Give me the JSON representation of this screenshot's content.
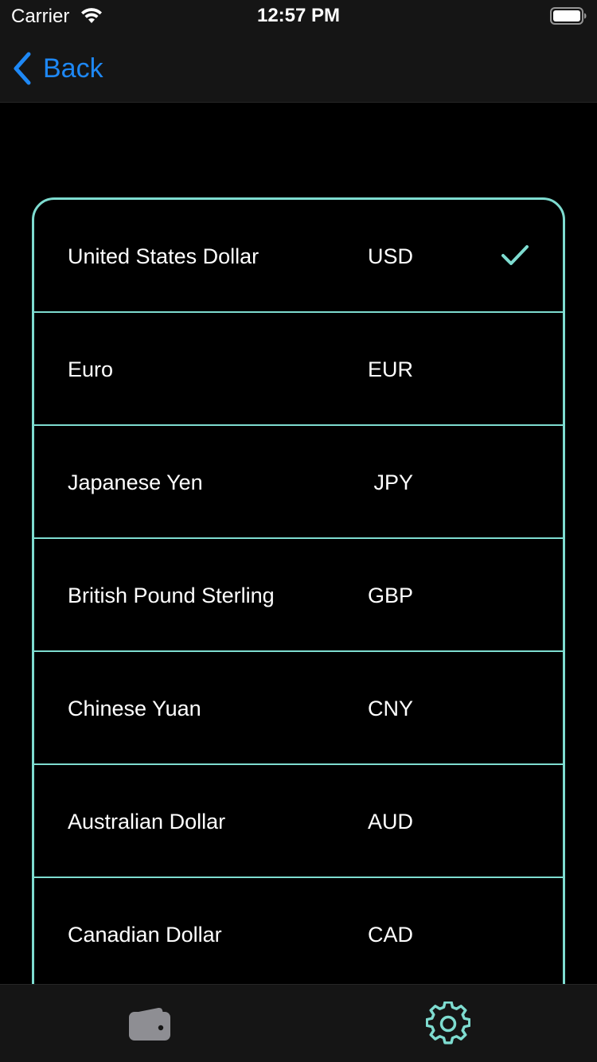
{
  "status_bar": {
    "carrier": "Carrier",
    "time": "12:57 PM"
  },
  "nav": {
    "back_label": "Back"
  },
  "colors": {
    "accent": "#7edcd0",
    "link": "#1e88f5",
    "background": "#000000",
    "bar_background": "#151515",
    "inactive_tab": "#8e8e93"
  },
  "currencies": [
    {
      "name": "United States Dollar",
      "code": "USD",
      "selected": true
    },
    {
      "name": "Euro",
      "code": "EUR",
      "selected": false
    },
    {
      "name": "Japanese Yen",
      "code": "JPY",
      "selected": false
    },
    {
      "name": "British Pound Sterling",
      "code": "GBP",
      "selected": false
    },
    {
      "name": "Chinese Yuan",
      "code": "CNY",
      "selected": false
    },
    {
      "name": "Australian Dollar",
      "code": "AUD",
      "selected": false
    },
    {
      "name": "Canadian Dollar",
      "code": "CAD",
      "selected": false
    }
  ],
  "tabs": [
    {
      "icon": "wallet-icon",
      "selected": false
    },
    {
      "icon": "gear-icon",
      "selected": true
    }
  ]
}
